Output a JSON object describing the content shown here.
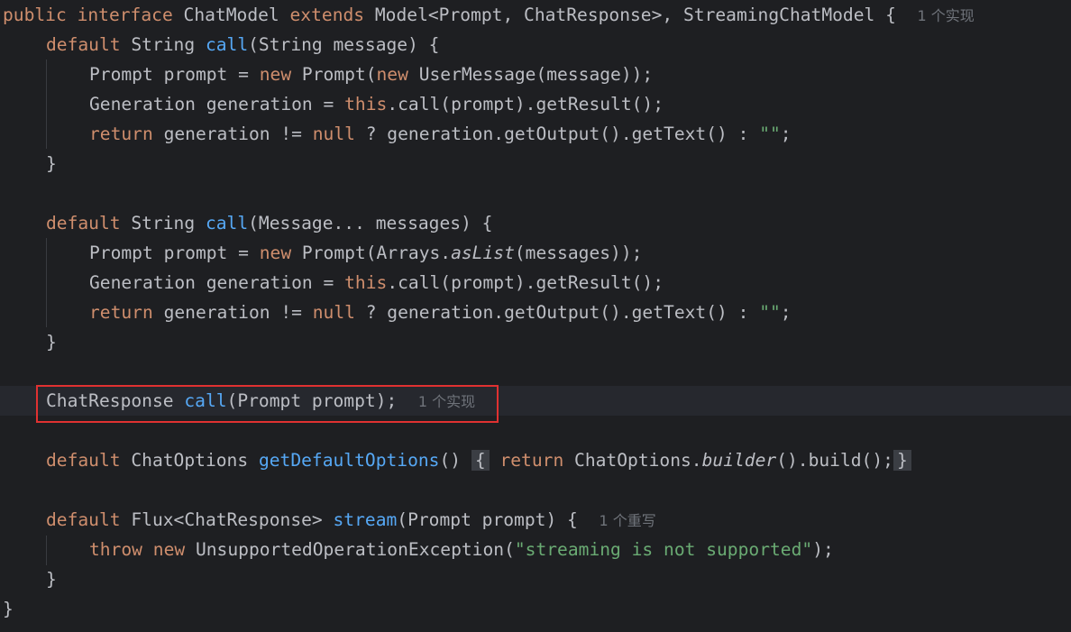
{
  "code": {
    "l1": [
      "public",
      "interface",
      "ChatModel",
      "extends",
      "Model<Prompt, ChatResponse>, StreamingChatModel {"
    ],
    "l1_hint": "1 个实现",
    "l2": [
      "default",
      "String",
      "call",
      "(String message) {"
    ],
    "l3": [
      "Prompt prompt = ",
      "new",
      " Prompt(",
      "new",
      " UserMessage(message));"
    ],
    "l4": [
      "Generation generation = ",
      "this",
      ".call(prompt).getResult();"
    ],
    "l5": [
      "return",
      " generation != ",
      "null",
      " ? generation.getOutput().getText() : ",
      "\"\"",
      ";"
    ],
    "l6": "}",
    "l8": [
      "default",
      "String",
      "call",
      "(Message... messages) {"
    ],
    "l9": [
      "Prompt prompt = ",
      "new",
      " Prompt(Arrays.",
      "asList",
      "(messages));"
    ],
    "l10": [
      "Generation generation = ",
      "this",
      ".call(prompt).getResult();"
    ],
    "l11": [
      "return",
      " generation != ",
      "null",
      " ? generation.getOutput().getText() : ",
      "\"\"",
      ";"
    ],
    "l12": "}",
    "l14": [
      "ChatResponse ",
      "call",
      "(Prompt prompt);"
    ],
    "l14_hint": "1 个实现",
    "l16": [
      "default",
      "ChatOptions",
      "getDefaultOptions",
      "()",
      "{",
      "return",
      " ChatOptions.",
      "builder",
      "().build();",
      "}"
    ],
    "l18": [
      "default",
      "Flux<ChatResponse>",
      "stream",
      "(Prompt prompt) {"
    ],
    "l18_hint": "1 个重写",
    "l19": [
      "throw",
      " ",
      "new",
      " UnsupportedOperationException(",
      "\"streaming is not supported\"",
      ");"
    ],
    "l20": "}",
    "l21": "}"
  },
  "colors": {
    "background": "#1e1f22",
    "keyword": "#cf8e6d",
    "function": "#56a8f5",
    "string": "#6aab73",
    "text": "#bcbec4",
    "hint": "#6f737a",
    "highlight_box": "#e03131"
  }
}
